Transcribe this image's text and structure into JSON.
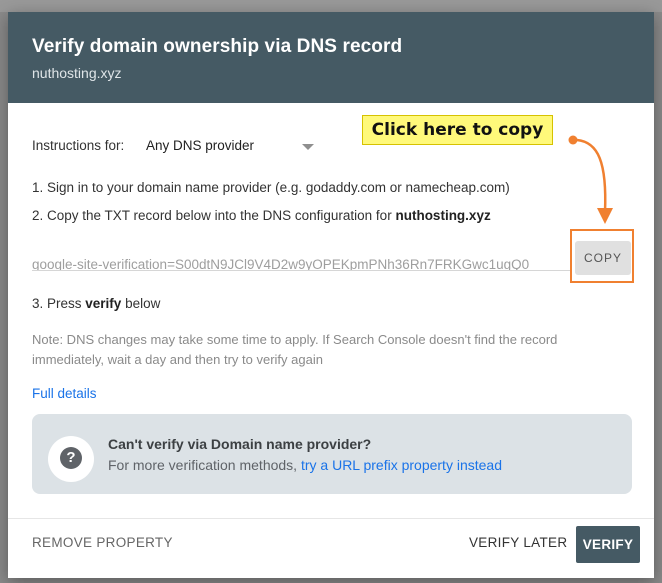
{
  "dialog": {
    "title": "Verify domain ownership via DNS record",
    "subtitle": "nuthosting.xyz"
  },
  "instructions": {
    "label": "Instructions for:",
    "provider_selected": "Any DNS provider"
  },
  "steps": {
    "step1": "1. Sign in to your domain name provider (e.g. godaddy.com or namecheap.com)",
    "step2_prefix": "2. Copy the TXT record below into the DNS configuration for ",
    "step2_domain": "nuthosting.xyz",
    "step3_prefix": "3. Press ",
    "step3_bold": "verify",
    "step3_suffix": " below"
  },
  "record": {
    "value": "google-site-verification=S00dtN9JCl9V4D2w9yOPEKpmPNh36Rn7FRKGwc1ugQ0",
    "copy_label": "COPY"
  },
  "annotation": {
    "callout_text": "Click here to copy",
    "colors": {
      "callout_bg": "#fff97a",
      "arrow": "#f08030"
    }
  },
  "note": "Note: DNS changes may take some time to apply. If Search Console doesn't find the record immediately, wait a day and then try to verify again",
  "full_details_link": "Full details",
  "alternative": {
    "title": "Can't verify via Domain name provider?",
    "body_prefix": "For more verification methods, ",
    "link": "try a URL prefix property instead",
    "icon": "help-icon"
  },
  "footer": {
    "remove_label": "REMOVE PROPERTY",
    "verify_later_label": "VERIFY LATER",
    "verify_label": "VERIFY"
  },
  "theme": {
    "header_bg": "#455a64",
    "link_color": "#1a73e8",
    "highlight_border": "#f08030"
  }
}
